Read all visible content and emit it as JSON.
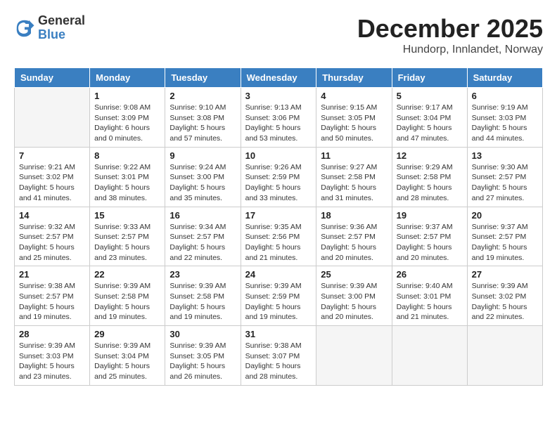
{
  "logo": {
    "general": "General",
    "blue": "Blue"
  },
  "header": {
    "month": "December 2025",
    "location": "Hundorp, Innlandet, Norway"
  },
  "weekdays": [
    "Sunday",
    "Monday",
    "Tuesday",
    "Wednesday",
    "Thursday",
    "Friday",
    "Saturday"
  ],
  "weeks": [
    [
      {
        "day": "",
        "info": ""
      },
      {
        "day": "1",
        "info": "Sunrise: 9:08 AM\nSunset: 3:09 PM\nDaylight: 6 hours\nand 0 minutes."
      },
      {
        "day": "2",
        "info": "Sunrise: 9:10 AM\nSunset: 3:08 PM\nDaylight: 5 hours\nand 57 minutes."
      },
      {
        "day": "3",
        "info": "Sunrise: 9:13 AM\nSunset: 3:06 PM\nDaylight: 5 hours\nand 53 minutes."
      },
      {
        "day": "4",
        "info": "Sunrise: 9:15 AM\nSunset: 3:05 PM\nDaylight: 5 hours\nand 50 minutes."
      },
      {
        "day": "5",
        "info": "Sunrise: 9:17 AM\nSunset: 3:04 PM\nDaylight: 5 hours\nand 47 minutes."
      },
      {
        "day": "6",
        "info": "Sunrise: 9:19 AM\nSunset: 3:03 PM\nDaylight: 5 hours\nand 44 minutes."
      }
    ],
    [
      {
        "day": "7",
        "info": "Sunrise: 9:21 AM\nSunset: 3:02 PM\nDaylight: 5 hours\nand 41 minutes."
      },
      {
        "day": "8",
        "info": "Sunrise: 9:22 AM\nSunset: 3:01 PM\nDaylight: 5 hours\nand 38 minutes."
      },
      {
        "day": "9",
        "info": "Sunrise: 9:24 AM\nSunset: 3:00 PM\nDaylight: 5 hours\nand 35 minutes."
      },
      {
        "day": "10",
        "info": "Sunrise: 9:26 AM\nSunset: 2:59 PM\nDaylight: 5 hours\nand 33 minutes."
      },
      {
        "day": "11",
        "info": "Sunrise: 9:27 AM\nSunset: 2:58 PM\nDaylight: 5 hours\nand 31 minutes."
      },
      {
        "day": "12",
        "info": "Sunrise: 9:29 AM\nSunset: 2:58 PM\nDaylight: 5 hours\nand 28 minutes."
      },
      {
        "day": "13",
        "info": "Sunrise: 9:30 AM\nSunset: 2:57 PM\nDaylight: 5 hours\nand 27 minutes."
      }
    ],
    [
      {
        "day": "14",
        "info": "Sunrise: 9:32 AM\nSunset: 2:57 PM\nDaylight: 5 hours\nand 25 minutes."
      },
      {
        "day": "15",
        "info": "Sunrise: 9:33 AM\nSunset: 2:57 PM\nDaylight: 5 hours\nand 23 minutes."
      },
      {
        "day": "16",
        "info": "Sunrise: 9:34 AM\nSunset: 2:57 PM\nDaylight: 5 hours\nand 22 minutes."
      },
      {
        "day": "17",
        "info": "Sunrise: 9:35 AM\nSunset: 2:56 PM\nDaylight: 5 hours\nand 21 minutes."
      },
      {
        "day": "18",
        "info": "Sunrise: 9:36 AM\nSunset: 2:57 PM\nDaylight: 5 hours\nand 20 minutes."
      },
      {
        "day": "19",
        "info": "Sunrise: 9:37 AM\nSunset: 2:57 PM\nDaylight: 5 hours\nand 20 minutes."
      },
      {
        "day": "20",
        "info": "Sunrise: 9:37 AM\nSunset: 2:57 PM\nDaylight: 5 hours\nand 19 minutes."
      }
    ],
    [
      {
        "day": "21",
        "info": "Sunrise: 9:38 AM\nSunset: 2:57 PM\nDaylight: 5 hours\nand 19 minutes."
      },
      {
        "day": "22",
        "info": "Sunrise: 9:39 AM\nSunset: 2:58 PM\nDaylight: 5 hours\nand 19 minutes."
      },
      {
        "day": "23",
        "info": "Sunrise: 9:39 AM\nSunset: 2:58 PM\nDaylight: 5 hours\nand 19 minutes."
      },
      {
        "day": "24",
        "info": "Sunrise: 9:39 AM\nSunset: 2:59 PM\nDaylight: 5 hours\nand 19 minutes."
      },
      {
        "day": "25",
        "info": "Sunrise: 9:39 AM\nSunset: 3:00 PM\nDaylight: 5 hours\nand 20 minutes."
      },
      {
        "day": "26",
        "info": "Sunrise: 9:40 AM\nSunset: 3:01 PM\nDaylight: 5 hours\nand 21 minutes."
      },
      {
        "day": "27",
        "info": "Sunrise: 9:39 AM\nSunset: 3:02 PM\nDaylight: 5 hours\nand 22 minutes."
      }
    ],
    [
      {
        "day": "28",
        "info": "Sunrise: 9:39 AM\nSunset: 3:03 PM\nDaylight: 5 hours\nand 23 minutes."
      },
      {
        "day": "29",
        "info": "Sunrise: 9:39 AM\nSunset: 3:04 PM\nDaylight: 5 hours\nand 25 minutes."
      },
      {
        "day": "30",
        "info": "Sunrise: 9:39 AM\nSunset: 3:05 PM\nDaylight: 5 hours\nand 26 minutes."
      },
      {
        "day": "31",
        "info": "Sunrise: 9:38 AM\nSunset: 3:07 PM\nDaylight: 5 hours\nand 28 minutes."
      },
      {
        "day": "",
        "info": ""
      },
      {
        "day": "",
        "info": ""
      },
      {
        "day": "",
        "info": ""
      }
    ]
  ]
}
